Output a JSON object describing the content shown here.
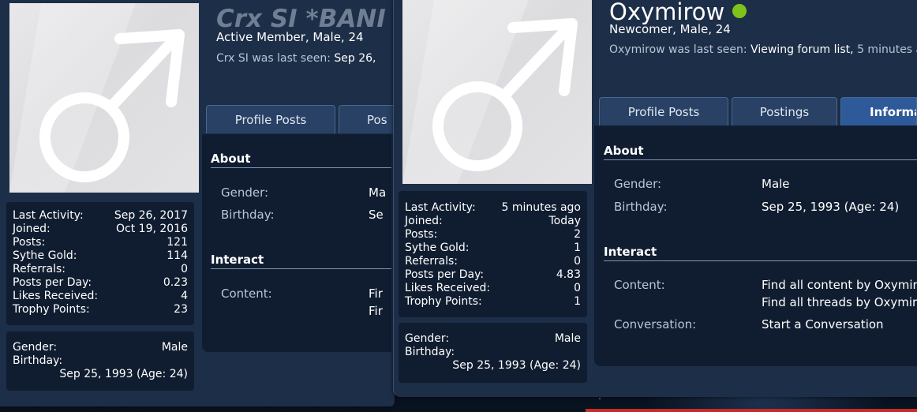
{
  "left_profile": {
    "username": "Crx SI *BANI",
    "subtitle": "Active Member, Male, 24",
    "last_seen_label": "Crx SI was last seen:",
    "last_seen_value": "Sep 26,",
    "tabs": [
      "Profile Posts",
      "Pos"
    ],
    "stats": [
      {
        "label": "Last Activity:",
        "value": "Sep 26, 2017"
      },
      {
        "label": "Joined:",
        "value": "Oct 19, 2016"
      },
      {
        "label": "Posts:",
        "value": "121"
      },
      {
        "label": "Sythe Gold:",
        "value": "114"
      },
      {
        "label": "Referrals:",
        "value": "0"
      },
      {
        "label": "Posts per Day:",
        "value": "0.23"
      },
      {
        "label": "Likes Received:",
        "value": "4"
      },
      {
        "label": "Trophy Points:",
        "value": "23"
      }
    ],
    "info": {
      "gender_label": "Gender:",
      "gender_value": "Male",
      "birthday_label": "Birthday:",
      "birthday_value": "Sep 25, 1993 (Age: 24)"
    },
    "about": {
      "title": "About",
      "gender_label": "Gender:",
      "gender_value": "Ma",
      "birthday_label": "Birthday:",
      "birthday_value": "Se"
    },
    "interact": {
      "title": "Interact",
      "content_label": "Content:",
      "content_line1": "Fir",
      "content_line2": "Fir"
    }
  },
  "right_profile": {
    "username": "Oxymirow",
    "subtitle": "Newcomer, Male, 24",
    "last_seen_label": "Oxymirow was last seen:",
    "last_seen_value": "Viewing forum list,",
    "last_seen_time": "5 minutes a",
    "tabs": [
      "Profile Posts",
      "Postings",
      "Informa"
    ],
    "stats": [
      {
        "label": "Last Activity:",
        "value": "5 minutes ago"
      },
      {
        "label": "Joined:",
        "value": "Today"
      },
      {
        "label": "Posts:",
        "value": "2"
      },
      {
        "label": "Sythe Gold:",
        "value": "1"
      },
      {
        "label": "Referrals:",
        "value": "0"
      },
      {
        "label": "Posts per Day:",
        "value": "4.83"
      },
      {
        "label": "Likes Received:",
        "value": "0"
      },
      {
        "label": "Trophy Points:",
        "value": "1"
      }
    ],
    "info": {
      "gender_label": "Gender:",
      "gender_value": "Male",
      "birthday_label": "Birthday:",
      "birthday_value": "Sep 25, 1993 (Age: 24)"
    },
    "about": {
      "title": "About",
      "gender_label": "Gender:",
      "gender_value": "Male",
      "birthday_label": "Birthday:",
      "birthday_value": "Sep 25, 1993 (Age: 24)"
    },
    "interact": {
      "title": "Interact",
      "content_label": "Content:",
      "content_line1": "Find all content by Oxymir",
      "content_line2": "Find all threads by Oxymir",
      "conversation_label": "Conversation:",
      "conversation_value": "Start a Conversation"
    }
  },
  "colors": {
    "online": "#7ec31c",
    "active_tab": "#2e5a9a",
    "panel": "#1d2e48",
    "box": "#101d30"
  }
}
